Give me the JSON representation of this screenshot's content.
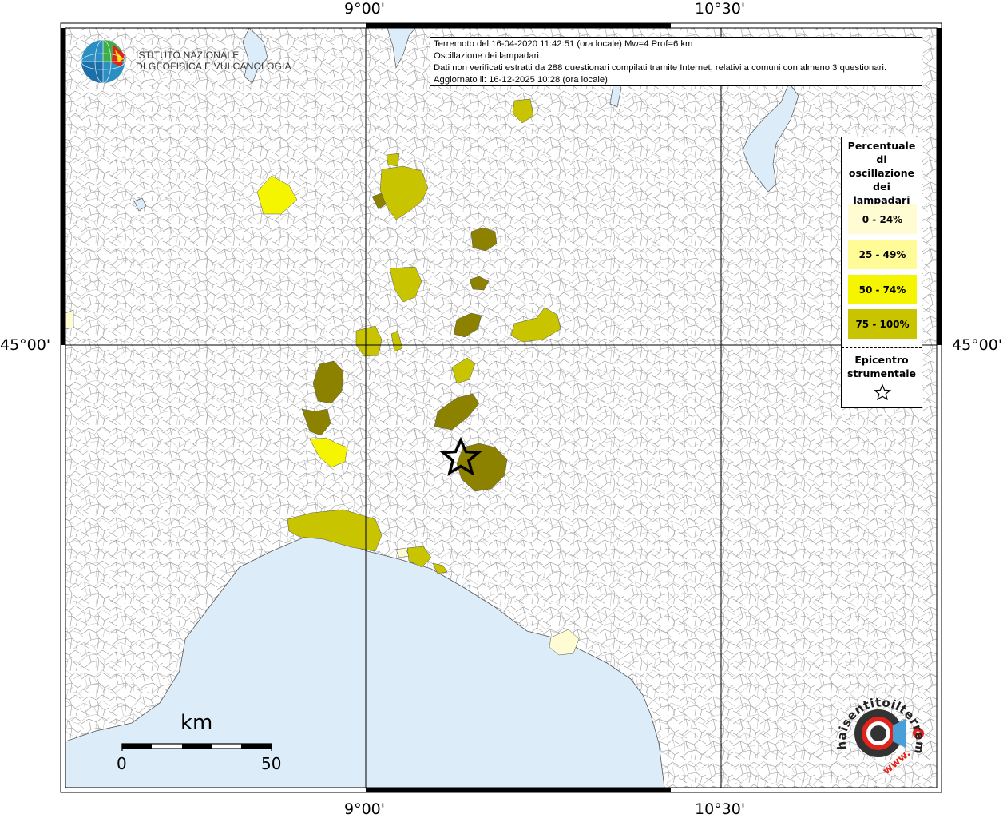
{
  "map": {
    "lon_labels": [
      "9°00'",
      "10°30'"
    ],
    "lat_labels": [
      "45°00'"
    ],
    "colors": {
      "sea": "#dcedf9",
      "land": "#ffffff",
      "class_0_24": "#fffbd2",
      "class_25_49": "#fffb96",
      "class_50_74": "#f5f500",
      "class_75_100": "#c8c500",
      "class_75_100_dark": "#8c8200"
    }
  },
  "info": {
    "line1": "Terremoto del 16-04-2020 11:42:51 (ora locale) Mw=4 Prof=6 km",
    "line2": "Oscillazione dei lampadari",
    "line3": "Dati non verificati estratti da 288 questionari compilati tramite Internet, relativi a comuni con almeno 3 questionari.",
    "line4": "Aggiornato il: 16-12-2025 10:28 (ora locale)"
  },
  "logo": {
    "line1": "ISTITUTO NAZIONALE",
    "line2": "DI GEOFISICA E VULCANOLOGIA"
  },
  "legend": {
    "title_lines": [
      "Percentuale",
      "di",
      "oscillazione",
      "dei",
      "lampadari"
    ],
    "items": [
      {
        "label": "0 - 24%",
        "color": "#fffbd2"
      },
      {
        "label": "25 - 49%",
        "color": "#fffb96"
      },
      {
        "label": "50 - 74%",
        "color": "#f5f500"
      },
      {
        "label": "75 - 100%",
        "color": "#c8c500"
      }
    ],
    "epicenter_lines": [
      "Epicentro",
      "strumentale"
    ],
    "epicenter_icon": "star-outline-icon"
  },
  "scale": {
    "unit": "km",
    "start": "0",
    "end": "50"
  },
  "brand": {
    "text": "haisentitoilterremoto.it",
    "prefix": "www."
  }
}
